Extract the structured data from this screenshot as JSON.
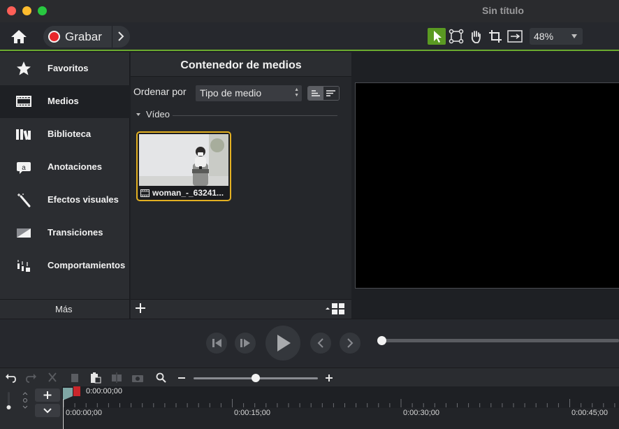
{
  "window": {
    "title": "Sin título"
  },
  "toolbar": {
    "record_label": "Grabar",
    "zoom_value": "48%",
    "tools": [
      "pointer-tool",
      "transform-tool",
      "hand-tool",
      "crop-tool",
      "pan-zoom-tool"
    ]
  },
  "sidebar": {
    "items": [
      {
        "label": "Favoritos",
        "icon": "star-icon"
      },
      {
        "label": "Medios",
        "icon": "film-icon"
      },
      {
        "label": "Biblioteca",
        "icon": "library-icon"
      },
      {
        "label": "Anotaciones",
        "icon": "annotation-icon"
      },
      {
        "label": "Efectos visuales",
        "icon": "magic-wand-icon"
      },
      {
        "label": "Transiciones",
        "icon": "transition-icon"
      },
      {
        "label": "Comportamientos",
        "icon": "behaviors-icon"
      }
    ],
    "more_label": "Más"
  },
  "media_bin": {
    "title": "Contenedor de medios",
    "sort_label": "Ordenar por",
    "sort_value": "Tipo de medio",
    "section_label": "Vídeo",
    "item_name": "woman_-_63241..."
  },
  "timeline": {
    "playhead_time": "0:00:00;00",
    "ruler_labels": [
      "0:00:00;00",
      "0:00:15;00",
      "0:00:30;00",
      "0:00:45;00"
    ]
  },
  "colors": {
    "accent_green": "#6cab2f",
    "record_red": "#e8272b",
    "selection_yellow": "#e3b022"
  }
}
